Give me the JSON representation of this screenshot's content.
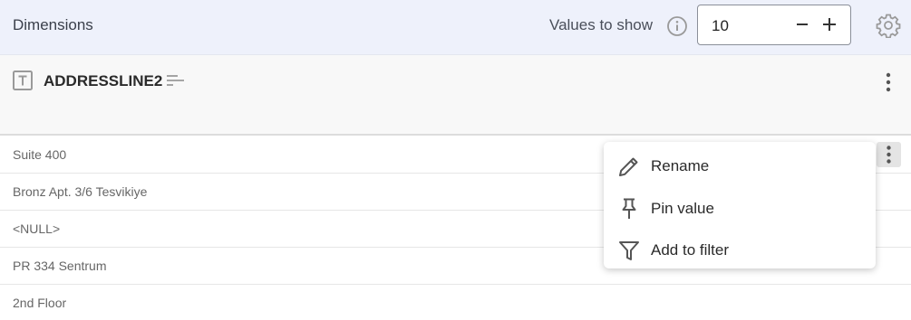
{
  "header": {
    "title": "Dimensions",
    "values_label": "Values to show",
    "values_count": "10"
  },
  "field": {
    "name": "ADDRESSLINE2",
    "type_icon_letter": "T"
  },
  "rows": [
    {
      "value": "Suite 400"
    },
    {
      "value": "Bronz Apt. 3/6 Tesvikiye"
    },
    {
      "value": "<NULL>"
    },
    {
      "value": "PR 334 Sentrum"
    },
    {
      "value": "2nd Floor"
    }
  ],
  "context_menu": {
    "items": [
      {
        "label": "Rename",
        "icon": "pencil-icon"
      },
      {
        "label": "Pin value",
        "icon": "pin-icon"
      },
      {
        "label": "Add to filter",
        "icon": "filter-icon"
      }
    ]
  },
  "colors": {
    "header_bg": "#eef1fb",
    "field_header_bg": "#f8f8f8",
    "icon_gray": "#9a9a9a"
  }
}
